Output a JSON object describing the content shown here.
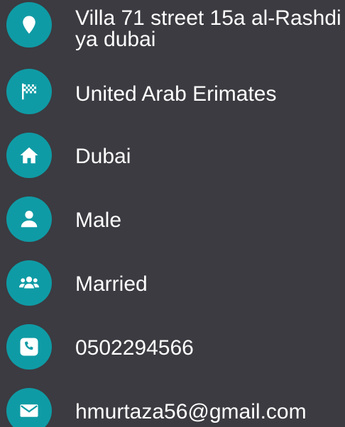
{
  "colors": {
    "background": "#3b3b41",
    "accent": "#0f9ba5",
    "text": "#ffffff"
  },
  "profile": {
    "items": [
      {
        "icon": "location-pin-icon",
        "value": "Villa 71 street 15a al-Rashdiya dubai"
      },
      {
        "icon": "checkered-flag-icon",
        "value": "United Arab Erimates"
      },
      {
        "icon": "home-icon",
        "value": "Dubai"
      },
      {
        "icon": "person-icon",
        "value": "Male"
      },
      {
        "icon": "group-icon",
        "value": "Married"
      },
      {
        "icon": "phone-icon",
        "value": "0502294566"
      },
      {
        "icon": "envelope-icon",
        "value": "hmurtaza56@gmail.com"
      }
    ]
  }
}
